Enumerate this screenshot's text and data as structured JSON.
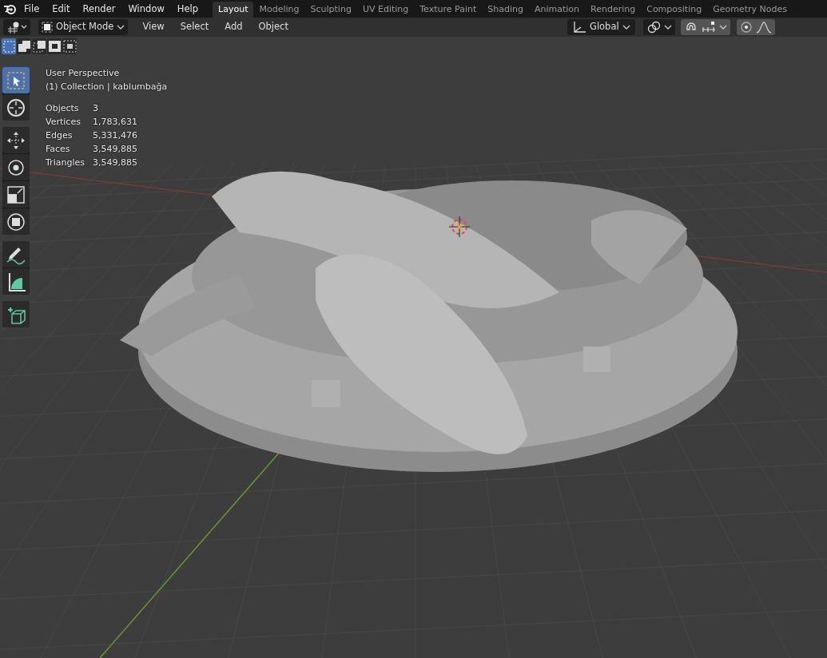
{
  "menu": [
    "File",
    "Edit",
    "Render",
    "Window",
    "Help"
  ],
  "workspaces": [
    {
      "label": "Layout",
      "selected": true
    },
    {
      "label": "Modeling",
      "selected": false
    },
    {
      "label": "Sculpting",
      "selected": false
    },
    {
      "label": "UV Editing",
      "selected": false
    },
    {
      "label": "Texture Paint",
      "selected": false
    },
    {
      "label": "Shading",
      "selected": false
    },
    {
      "label": "Animation",
      "selected": false
    },
    {
      "label": "Rendering",
      "selected": false
    },
    {
      "label": "Compositing",
      "selected": false
    },
    {
      "label": "Geometry Nodes",
      "selected": false
    }
  ],
  "header": {
    "mode": "Object Mode",
    "menus": [
      "View",
      "Select",
      "Add",
      "Object"
    ],
    "orientation": "Global",
    "snap": {
      "on": true
    },
    "proportional_editing": {
      "on": true
    }
  },
  "select_modes": [
    {
      "kind": "set",
      "selected": true
    },
    {
      "kind": "extend",
      "selected": false
    },
    {
      "kind": "subtract",
      "selected": false
    },
    {
      "kind": "invert",
      "selected": false
    },
    {
      "kind": "intersect",
      "selected": false
    }
  ],
  "tool_groups": [
    {
      "tools": [
        {
          "kind": "select",
          "selected": true
        },
        {
          "kind": "cursor",
          "selected": false
        }
      ]
    },
    {
      "tools": [
        {
          "kind": "move",
          "selected": false
        },
        {
          "kind": "rotate",
          "selected": false
        },
        {
          "kind": "scale",
          "selected": false
        },
        {
          "kind": "transform",
          "selected": false
        }
      ]
    },
    {
      "tools": [
        {
          "kind": "annotate",
          "selected": false
        },
        {
          "kind": "measure",
          "selected": false
        }
      ]
    },
    {
      "tools": [
        {
          "kind": "add_cube",
          "selected": false
        }
      ]
    }
  ],
  "overlay": {
    "view": "User Perspective",
    "collection": "(1) Collection | kablumbağa",
    "stats": [
      {
        "label": "Objects",
        "value": "3"
      },
      {
        "label": "Vertices",
        "value": "1,783,631"
      },
      {
        "label": "Edges",
        "value": "5,331,476"
      },
      {
        "label": "Faces",
        "value": "3,549,885"
      },
      {
        "label": "Triangles",
        "value": "3,549,885"
      }
    ]
  }
}
